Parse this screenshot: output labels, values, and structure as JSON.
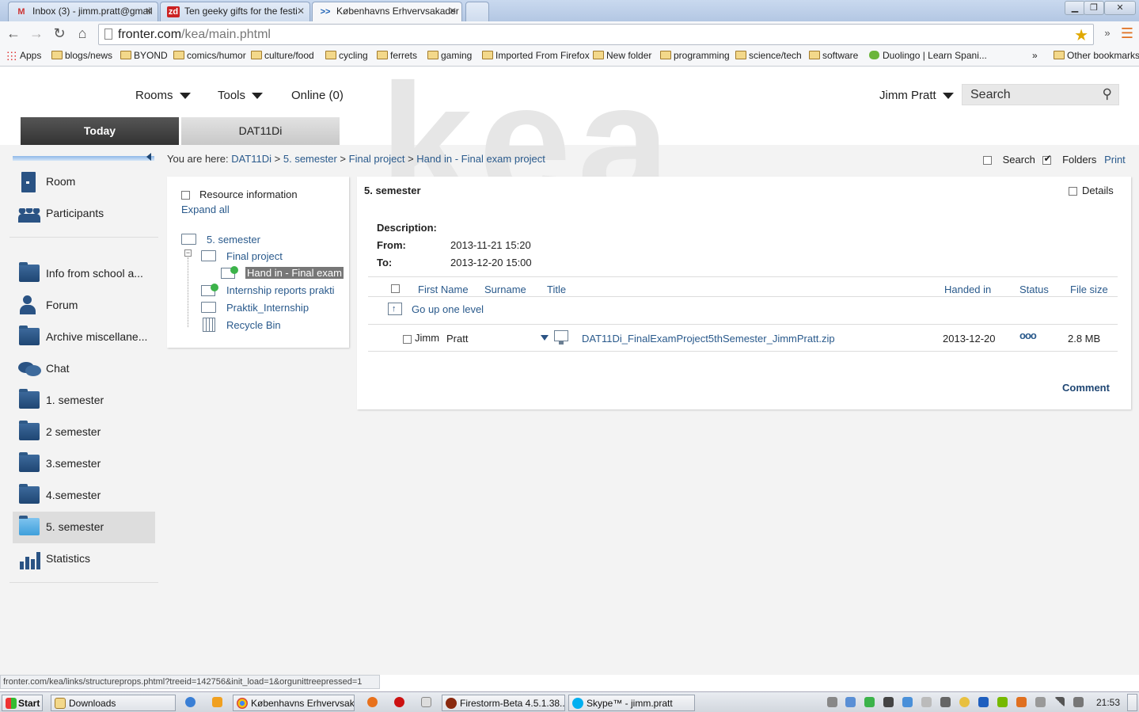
{
  "browser": {
    "tabs": [
      {
        "title": "Inbox (3) - jimm.pratt@gmail",
        "icon": "gmail-icon"
      },
      {
        "title": "Ten geeky gifts for the festi",
        "icon": "zd-icon"
      },
      {
        "title": "Københavns Erhvervsakader",
        "icon": "fronter-icon"
      }
    ],
    "url_host": "fronter.com",
    "url_path": "/kea/main.phtml",
    "bookmarks": [
      "Apps",
      "blogs/news",
      "BYOND",
      "comics/humor",
      "culture/food",
      "cycling",
      "ferrets",
      "gaming",
      "Imported From Firefox",
      "New folder",
      "programming",
      "science/tech",
      "software",
      "Duolingo | Learn Spani...",
      "»",
      "Other bookmarks"
    ]
  },
  "header": {
    "logo_text": "kea",
    "menu": {
      "rooms": "Rooms",
      "tools": "Tools",
      "online": "Online (0)"
    },
    "user": "Jimm Pratt",
    "search_placeholder": "Search",
    "tabs": {
      "today": "Today",
      "room": "DAT11Di"
    }
  },
  "sidebar": {
    "top": [
      {
        "label": "Room",
        "icon": "door-icon"
      },
      {
        "label": "Participants",
        "icon": "people-icon"
      }
    ],
    "items": [
      {
        "label": "Info from school a...",
        "icon": "folder-icon"
      },
      {
        "label": "Forum",
        "icon": "forum-icon"
      },
      {
        "label": "Archive miscellane...",
        "icon": "folder-icon"
      },
      {
        "label": "Chat",
        "icon": "chat-icon"
      },
      {
        "label": "1. semester",
        "icon": "folder-icon"
      },
      {
        "label": "2 semester",
        "icon": "folder-icon"
      },
      {
        "label": "3.semester",
        "icon": "folder-icon"
      },
      {
        "label": "4.semester",
        "icon": "folder-icon"
      },
      {
        "label": "5. semester",
        "icon": "folder-icon"
      },
      {
        "label": "Statistics",
        "icon": "statistics-icon"
      }
    ]
  },
  "breadcrumb": {
    "prefix": "You are here:",
    "parts": [
      "DAT11Di",
      "5. semester",
      "Final project",
      "Hand in - Final exam project"
    ],
    "sep": ">"
  },
  "options": {
    "search": "Search",
    "folders": "Folders",
    "print": "Print"
  },
  "tree": {
    "resource_info": "Resource information",
    "expand_all": "Expand all",
    "nodes": [
      "5. semester",
      "Final project",
      "Hand in - Final exam",
      "Internship reports prakti",
      "Praktik_Internship",
      "Recycle Bin"
    ]
  },
  "main": {
    "title": "5. semester",
    "details": "Details",
    "description_label": "Description:",
    "from_label": "From:",
    "from_value": "2013-11-21 15:20",
    "to_label": "To:",
    "to_value": "2013-12-20 15:00",
    "columns": [
      "First Name",
      "Surname",
      "Title",
      "Handed in",
      "Status",
      "File size"
    ],
    "go_up": "Go up one level",
    "row": {
      "first": "Jimm",
      "last": "Pratt",
      "title": "DAT11Di_FinalExamProject5thSemester_JimmPratt.zip",
      "handed_in": "2013-12-20",
      "status": "ooo",
      "size": "2.8 MB"
    },
    "comment": "Comment"
  },
  "statusbar": "fronter.com/kea/links/structureprops.phtml?treeid=142756&init_load=1&orgunittreepressed=1",
  "taskbar": {
    "start": "Start",
    "items": [
      "Downloads",
      "Københavns Erhvervsak...",
      "Firestorm-Beta 4.5.1.38...",
      "Skype™ - jimm.pratt"
    ],
    "clock": "21:53"
  }
}
